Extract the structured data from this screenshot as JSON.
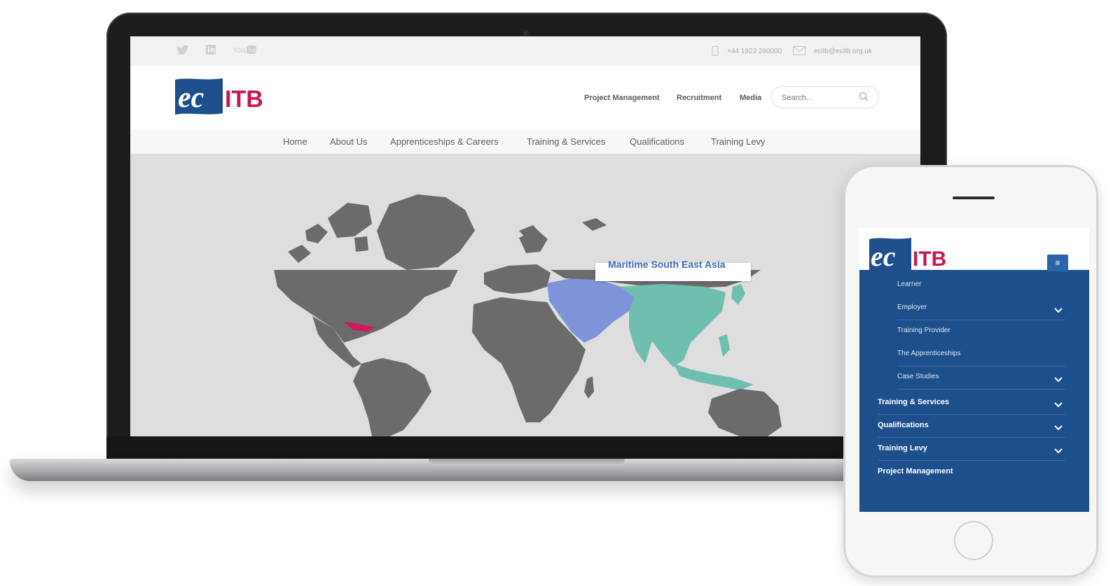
{
  "desktop": {
    "topbar": {
      "social_icons": [
        "twitter-icon",
        "linkedin-icon",
        "youtube-icon"
      ],
      "phone": "+44 1923 260000",
      "email": "ecitb@ecitb.org.uk"
    },
    "logo": {
      "ec": "ec",
      "itb": "ITB"
    },
    "secondary_nav": [
      "Project Management",
      "Recruitment",
      "Media"
    ],
    "search": {
      "placeholder": "Search..."
    },
    "main_nav": [
      "Home",
      "About Us",
      "Apprenticeships & Careers",
      "Training & Services",
      "Qualifications",
      "Training Levy"
    ],
    "map": {
      "tooltip": "Maritime South East Asia",
      "colors": {
        "land": "#6b6b6b",
        "sea": "#dedede",
        "highlight_blue": "#7f93d8",
        "highlight_teal": "#6fbfb0",
        "highlight_pink": "#d4165a"
      }
    }
  },
  "mobile": {
    "logo": {
      "ec": "ec",
      "itb": "ITB"
    },
    "menu_icon": "hamburger-icon",
    "menu": [
      {
        "label": "Learner",
        "level": "sub",
        "expandable": false
      },
      {
        "label": "Employer",
        "level": "sub",
        "expandable": true
      },
      {
        "label": "Training Provider",
        "level": "sub",
        "expandable": false
      },
      {
        "label": "The Apprenticeships",
        "level": "sub",
        "expandable": false
      },
      {
        "label": "Case Studies",
        "level": "sub",
        "expandable": true
      },
      {
        "label": "Training & Services",
        "level": "top",
        "expandable": true
      },
      {
        "label": "Qualifications",
        "level": "top",
        "expandable": true
      },
      {
        "label": "Training Levy",
        "level": "top",
        "expandable": true
      },
      {
        "label": "Project Management",
        "level": "top",
        "expandable": false
      }
    ]
  },
  "brand_colors": {
    "navy": "#1d4f8c",
    "crimson": "#c8184f"
  }
}
